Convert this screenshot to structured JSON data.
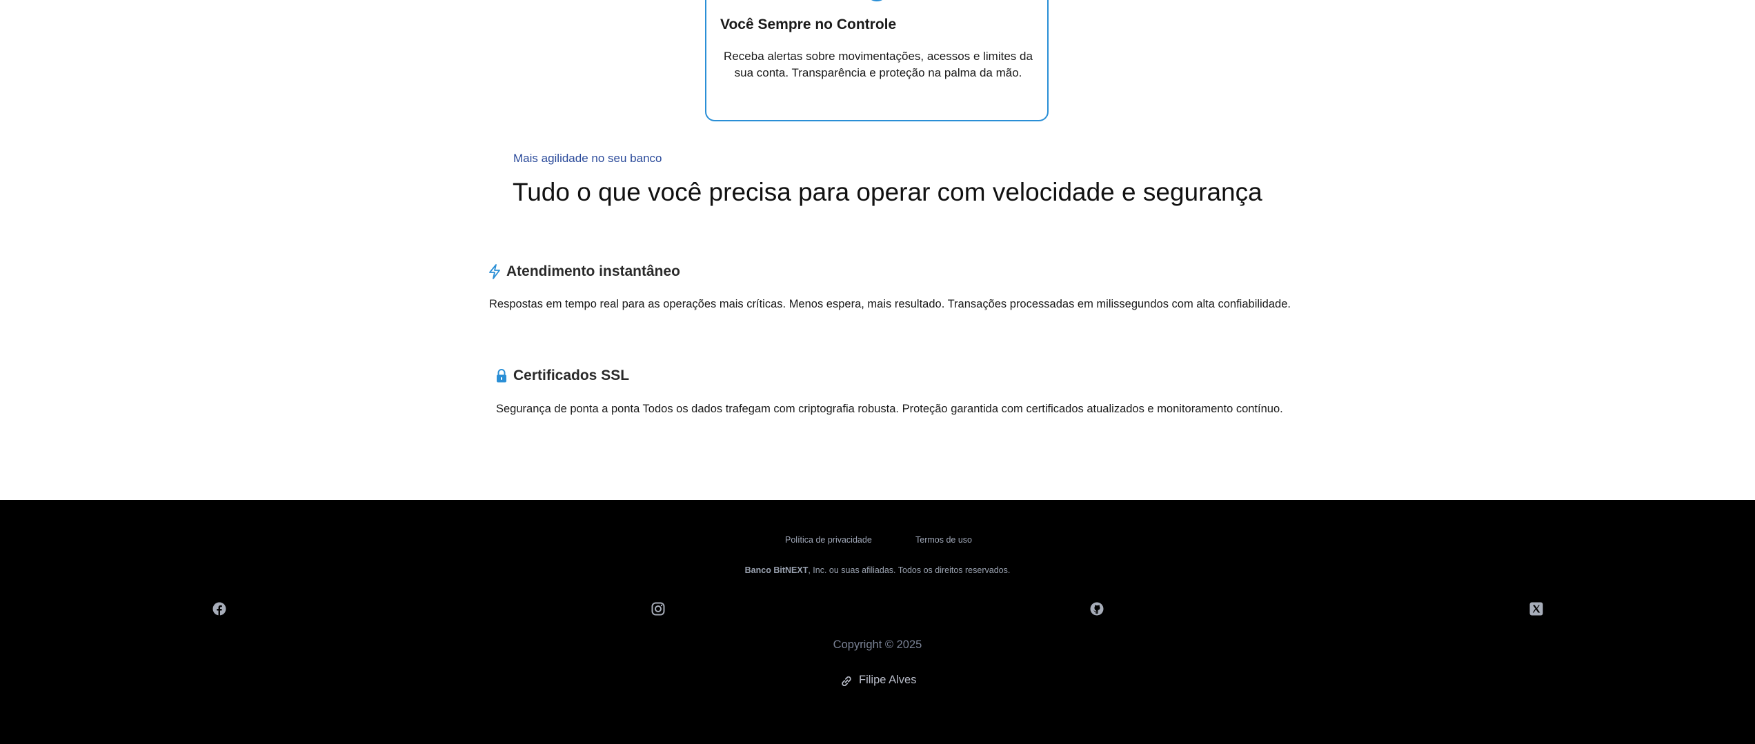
{
  "card": {
    "title": "Você Sempre no Controle",
    "text": "Receba alertas sobre movimentações, acessos e limites da sua conta. Transparência e proteção na palma da mão."
  },
  "section": {
    "eyebrow": "Mais agilidade no seu banco",
    "title": "Tudo o que você precisa para operar com velocidade e segurança"
  },
  "features": [
    {
      "icon": "lightning-icon",
      "title": "Atendimento instantâneo",
      "text": "Respostas em tempo real para as operações mais críticas. Menos espera, mais resultado. Transações processadas em milissegundos com alta confiabilidade."
    },
    {
      "icon": "lock-icon",
      "title": "Certificados SSL",
      "text": "Segurança de ponta a ponta Todos os dados trafegam com criptografia robusta. Proteção garantida com certificados atualizados e monitoramento contínuo."
    }
  ],
  "footer": {
    "links": {
      "privacy": "Política de privacidade",
      "terms": "Termos de uso"
    },
    "legal": {
      "brand": "Banco BitNEXT",
      "rest": ", Inc. ou suas afiliadas. Todos os direitos reservados."
    },
    "social": [
      "facebook-icon",
      "instagram-icon",
      "github-icon",
      "x-icon"
    ],
    "copyright": "Copyright © 2025",
    "author": "Filipe Alves"
  },
  "colors": {
    "accent": "#2a8fd6",
    "eyebrow": "#2a4a9a",
    "footer_bg": "#000000"
  }
}
